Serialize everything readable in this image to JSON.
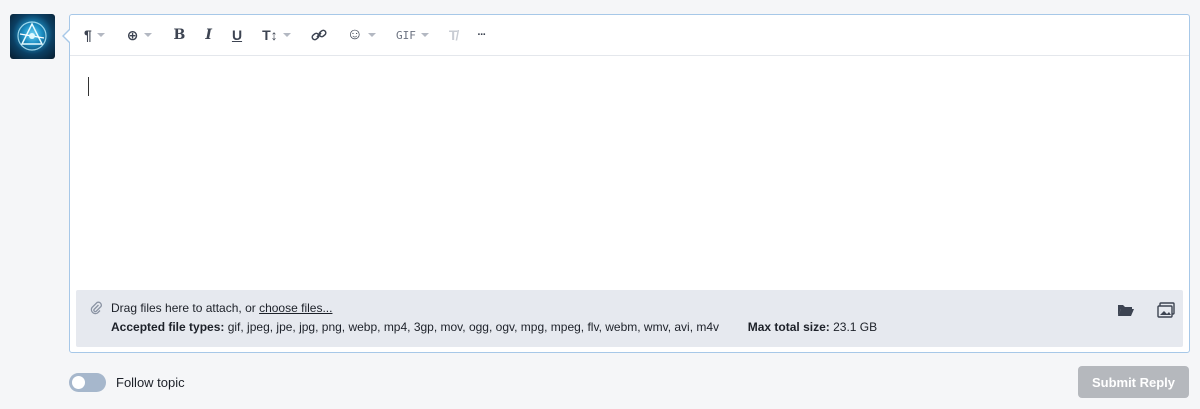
{
  "toolbar": {
    "paragraph_glyph": "¶",
    "insert_glyph": "⊕",
    "bold_glyph": "B",
    "italic_glyph": "I",
    "underline_glyph": "U",
    "text_size_glyph": "T↕",
    "link_glyph": "🔗",
    "emoji_glyph": "☺",
    "gif_label": "GIF",
    "clear_format_glyph": "T̸",
    "more_glyph": "···"
  },
  "attach": {
    "drag_text": "Drag files here to attach, or ",
    "choose_link": "choose files...",
    "accepted_label": "Accepted file types:",
    "accepted_types": " gif, jpeg, jpe, jpg, png, webp, mp4, 3gp, mov, ogg, ogv, mpg, mpeg, flv, webm, wmv, avi, m4v",
    "max_label": "Max total size:",
    "max_value": " 23.1 GB"
  },
  "footer": {
    "follow_label": "Follow topic",
    "submit_label": "Submit Reply"
  },
  "colors": {
    "editor_border": "#a7c8e8",
    "attach_bg": "#e6e9ef",
    "submit_disabled": "#b5b8bd"
  }
}
